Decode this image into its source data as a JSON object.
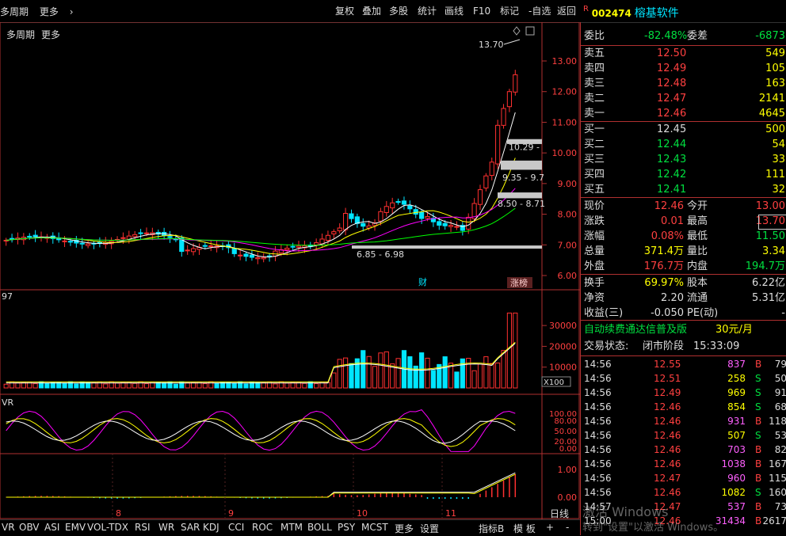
{
  "topbar": {
    "period": "多周期",
    "more": "更多",
    "buttons": [
      "复权",
      "叠加",
      "多股",
      "统计",
      "画线",
      "F10",
      "标记",
      "-自选",
      "返回"
    ]
  },
  "stock": {
    "flag": "R",
    "code": "002474",
    "name": "榕基软件"
  },
  "chart": {
    "price_axis": [
      "13.00",
      "12.00",
      "11.00",
      "10.00",
      "9.00",
      "8.00",
      "7.00",
      "6.00"
    ],
    "high_label": "13.70",
    "zone_labels": [
      "10.29 -",
      "9.35 - 9.7",
      "8.50 - 8.71",
      "6.85 - 6.98"
    ],
    "badge_cai": "财",
    "badge_zhangting": "涨榜",
    "vol_axis": [
      "30000",
      "20000",
      "10000"
    ],
    "vol_unit": "X100",
    "left_small": "97",
    "left_vr": "VR",
    "kdj_axis": [
      "100.00",
      "80.00",
      "50.00",
      "20.00",
      "0.00"
    ],
    "macd_axis": [
      "1.00",
      "0.00"
    ],
    "x_labels": [
      "8",
      "9",
      "10",
      "11"
    ]
  },
  "orderbook": {
    "weibi_label": "委比",
    "weibi_value": "-82.48%",
    "weicha_label": "委差",
    "weicha_value": "-6873",
    "sells": [
      {
        "label": "卖五",
        "price": "12.50",
        "vol": "549"
      },
      {
        "label": "卖四",
        "price": "12.49",
        "vol": "105"
      },
      {
        "label": "卖三",
        "price": "12.48",
        "vol": "163"
      },
      {
        "label": "卖二",
        "price": "12.47",
        "vol": "2141"
      },
      {
        "label": "卖一",
        "price": "12.46",
        "vol": "4645"
      }
    ],
    "buys": [
      {
        "label": "买一",
        "price": "12.45",
        "vol": "500"
      },
      {
        "label": "买二",
        "price": "12.44",
        "vol": "54"
      },
      {
        "label": "买三",
        "price": "12.43",
        "vol": "33"
      },
      {
        "label": "买四",
        "price": "12.42",
        "vol": "111"
      },
      {
        "label": "买五",
        "price": "12.41",
        "vol": "32"
      }
    ]
  },
  "quote": {
    "xianjia_l": "现价",
    "xianjia_v": "12.46",
    "jinkai_l": "今开",
    "jinkai_v": "13.00",
    "zhangdie_l": "涨跌",
    "zhangdie_v": "0.01",
    "zuigao_l": "最高",
    "zuigao_v": "13.70",
    "zhangfu_l": "涨幅",
    "zhangfu_v": "0.08%",
    "zuidi_l": "最低",
    "zuidi_v": "11.50",
    "zongliang_l": "总量",
    "zongliang_v": "371.4万",
    "liangbi_l": "量比",
    "liangbi_v": "3.34",
    "waipan_l": "外盘",
    "waipan_v": "176.7万",
    "neipan_l": "内盘",
    "neipan_v": "194.7万",
    "huanshou_l": "换手",
    "huanshou_v": "69.97%",
    "guben_l": "股本",
    "guben_v": "6.22亿",
    "jingzi_l": "净资",
    "jingzi_v": "2.20",
    "liutong_l": "流通",
    "liutong_v": "5.31亿",
    "shouyi_l": "收益(三)",
    "shouyi_v": "-0.050",
    "pe_l": "PE(动)",
    "pe_v": "-"
  },
  "promo": {
    "text": "自动续费通达信普及版",
    "price": "30元/月"
  },
  "status": {
    "label": "交易状态:",
    "value": "闭市阶段",
    "time": "15:33:09"
  },
  "ticks": [
    {
      "t": "14:56",
      "p": "12.55",
      "v": "837",
      "s": "B",
      "n": "79"
    },
    {
      "t": "14:56",
      "p": "12.51",
      "v": "258",
      "s": "S",
      "n": "50"
    },
    {
      "t": "14:56",
      "p": "12.49",
      "v": "969",
      "s": "S",
      "n": "91"
    },
    {
      "t": "14:56",
      "p": "12.46",
      "v": "854",
      "s": "S",
      "n": "68"
    },
    {
      "t": "14:56",
      "p": "12.46",
      "v": "931",
      "s": "B",
      "n": "118"
    },
    {
      "t": "14:56",
      "p": "12.46",
      "v": "507",
      "s": "S",
      "n": "53"
    },
    {
      "t": "14:56",
      "p": "12.46",
      "v": "703",
      "s": "B",
      "n": "82"
    },
    {
      "t": "14:56",
      "p": "12.46",
      "v": "1038",
      "s": "B",
      "n": "167"
    },
    {
      "t": "14:56",
      "p": "12.47",
      "v": "960",
      "s": "B",
      "n": "115"
    },
    {
      "t": "14:56",
      "p": "12.46",
      "v": "1082",
      "s": "S",
      "n": "160"
    },
    {
      "t": "14:57",
      "p": "12.47",
      "v": "537",
      "s": "B",
      "n": "73"
    },
    {
      "t": "15:00",
      "p": "12.46",
      "v": "31434",
      "s": "B",
      "n": "2617"
    }
  ],
  "bottom": {
    "tabs": [
      "VR",
      "OBV",
      "ASI",
      "EMV",
      "VOL-TDX",
      "RSI",
      "WR",
      "SAR",
      "KDJ",
      "CCI",
      "ROC",
      "MTM",
      "BOLL",
      "PSY",
      "MCST",
      "更多",
      "设置"
    ],
    "zhibiao": "指标B",
    "moban": "模 板",
    "plus": "+",
    "minus": "-",
    "rixian": "日线"
  },
  "watermark": {
    "line1": "激活 Windows",
    "line2": "转到\"设置\"以激活 Windows。"
  },
  "colors": {
    "up": "#ff3030",
    "down": "#00e5ff",
    "frame": "#b03030",
    "ma5": "#ffffff",
    "ma10": "#ffff00",
    "ma20": "#ff00ff",
    "ma60": "#00ff00"
  }
}
